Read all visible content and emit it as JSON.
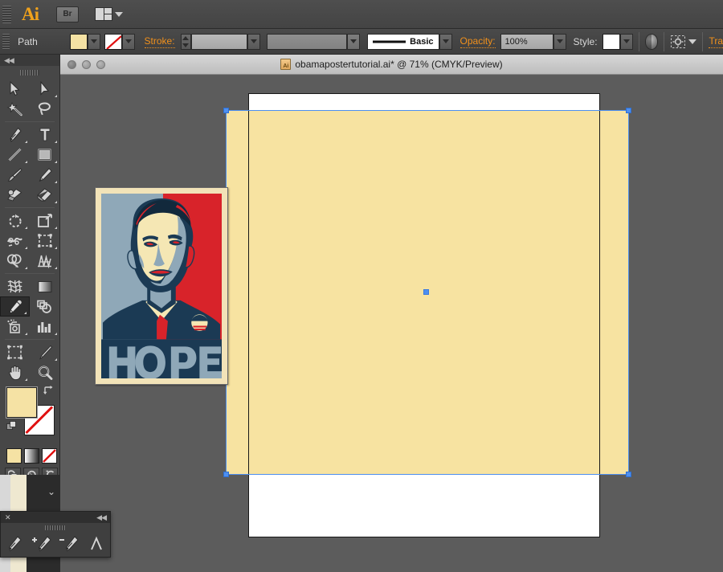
{
  "app": {
    "name": "Ai",
    "bridge_label": "Br",
    "workspace_icon": "workspace-switcher-icon"
  },
  "control_bar": {
    "object_label": "Path",
    "fill_color": "#F5E2A4",
    "stroke_color": "none",
    "stroke_label": "Stroke:",
    "stroke_weight": "",
    "stroke_profile": "",
    "brush_definition": "Basic",
    "opacity_label": "Opacity:",
    "opacity_value": "100%",
    "style_label": "Style:",
    "transparency_label": "Tra",
    "align_icon": "align-object-icon",
    "select_similar_icon": "select-similar-icon"
  },
  "document": {
    "title": "obamapostertutorial.ai* @ 71% (CMYK/Preview)",
    "file_name": "obamapostertutorial.ai*",
    "zoom": "71%",
    "color_mode": "CMYK",
    "view_mode": "Preview",
    "file_icon": "illustrator-file-icon"
  },
  "tools": {
    "collapse_icon": "collapse-panel-icon",
    "items": [
      {
        "name": "selection-tool",
        "label": "Selection",
        "selected": false,
        "has_flyout": false
      },
      {
        "name": "direct-selection-tool",
        "label": "Direct Selection",
        "selected": false,
        "has_flyout": true
      },
      {
        "name": "magic-wand-tool",
        "label": "Magic Wand",
        "selected": false,
        "has_flyout": false
      },
      {
        "name": "lasso-tool",
        "label": "Lasso",
        "selected": false,
        "has_flyout": false
      },
      {
        "name": "pen-tool",
        "label": "Pen",
        "selected": false,
        "has_flyout": true
      },
      {
        "name": "type-tool",
        "label": "Type",
        "selected": false,
        "has_flyout": true
      },
      {
        "name": "line-segment-tool",
        "label": "Line Segment",
        "selected": false,
        "has_flyout": true
      },
      {
        "name": "rectangle-tool",
        "label": "Rectangle",
        "selected": false,
        "has_flyout": true
      },
      {
        "name": "paintbrush-tool",
        "label": "Paintbrush",
        "selected": false,
        "has_flyout": false
      },
      {
        "name": "pencil-tool",
        "label": "Pencil",
        "selected": false,
        "has_flyout": true
      },
      {
        "name": "blob-brush-tool",
        "label": "Blob Brush",
        "selected": false,
        "has_flyout": false
      },
      {
        "name": "eraser-tool",
        "label": "Eraser",
        "selected": false,
        "has_flyout": true
      },
      {
        "name": "rotate-tool",
        "label": "Rotate",
        "selected": false,
        "has_flyout": true
      },
      {
        "name": "scale-tool",
        "label": "Scale",
        "selected": false,
        "has_flyout": true
      },
      {
        "name": "width-warp-tool",
        "label": "Warp",
        "selected": false,
        "has_flyout": true
      },
      {
        "name": "free-transform-tool",
        "label": "Free Transform",
        "selected": false,
        "has_flyout": true
      },
      {
        "name": "shape-builder-tool",
        "label": "Shape Builder",
        "selected": false,
        "has_flyout": true
      },
      {
        "name": "perspective-grid-tool",
        "label": "Perspective Grid",
        "selected": false,
        "has_flyout": true
      },
      {
        "name": "mesh-tool",
        "label": "Mesh",
        "selected": false,
        "has_flyout": false
      },
      {
        "name": "gradient-tool",
        "label": "Gradient",
        "selected": false,
        "has_flyout": false
      },
      {
        "name": "eyedropper-tool",
        "label": "Eyedropper",
        "selected": true,
        "has_flyout": true
      },
      {
        "name": "blend-tool",
        "label": "Blend",
        "selected": false,
        "has_flyout": false
      },
      {
        "name": "symbol-sprayer-tool",
        "label": "Symbol Sprayer",
        "selected": false,
        "has_flyout": true
      },
      {
        "name": "column-graph-tool",
        "label": "Column Graph",
        "selected": false,
        "has_flyout": true
      },
      {
        "name": "artboard-tool",
        "label": "Artboard",
        "selected": false,
        "has_flyout": false
      },
      {
        "name": "slice-tool",
        "label": "Slice",
        "selected": false,
        "has_flyout": true
      },
      {
        "name": "hand-tool",
        "label": "Hand",
        "selected": false,
        "has_flyout": true
      },
      {
        "name": "zoom-tool",
        "label": "Zoom",
        "selected": false,
        "has_flyout": false
      }
    ],
    "fill_swatch_color": "#F5E2A4",
    "stroke_swatch_color": "#FFFFFF",
    "stroke_is_none": true,
    "color_modes": [
      "color-swatch",
      "gradient-swatch",
      "none-swatch"
    ],
    "draw_modes": [
      "draw-normal",
      "draw-behind",
      "draw-inside"
    ],
    "screen_mode": "change-screen-mode-icon"
  },
  "pen_panel": {
    "close_icon": "close-icon",
    "collapse_icon": "collapse-panel-icon",
    "tools": [
      {
        "name": "pen-tool",
        "label": "Pen"
      },
      {
        "name": "add-anchor-point-tool",
        "label": "Add Anchor Point"
      },
      {
        "name": "delete-anchor-point-tool",
        "label": "Delete Anchor Point"
      },
      {
        "name": "convert-anchor-point-tool",
        "label": "Convert Anchor Point"
      }
    ]
  },
  "canvas": {
    "background_color": "#5C5C5C",
    "artboard_color": "#FFFFFF",
    "selected_object": {
      "name": "yellow-rectangle",
      "fill": "#F7E3A1",
      "selection_color": "#4D8FF0",
      "handles": 4
    },
    "reference_image": {
      "name": "obama-hope-poster",
      "caption": "HOPE",
      "palette": {
        "cream": "#F5E7B4",
        "light_blue": "#8FA8B8",
        "dark_blue": "#1B3A54",
        "red": "#D8232A",
        "border": "#F2E3B8"
      }
    }
  }
}
